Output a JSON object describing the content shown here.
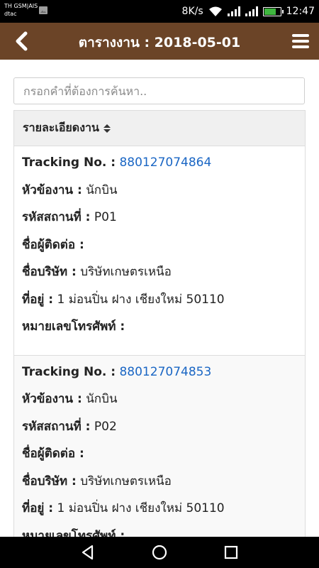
{
  "status_bar": {
    "carrier_line1": "TH GSM|AIS",
    "carrier_line2": "dtac",
    "speed": "8K/s",
    "time": "12:47",
    "battery_color": "#3fb63f"
  },
  "header": {
    "title": "ตารางงาน : 2018-05-01",
    "background_color": "#6b4427",
    "back_icon": "chevron-left-icon",
    "menu_icon": "hamburger-menu-icon"
  },
  "search": {
    "placeholder": "กรอกคำที่ต้องการค้นหา..",
    "value": ""
  },
  "table": {
    "column_header": "รายละเอียดงาน",
    "sort_icon": "sort-icon",
    "labels": {
      "tracking": "Tracking No. :",
      "topic": "หัวข้องาน :",
      "location_code": "รหัสสถานที่ :",
      "contact": "ชื่อผู้ติดต่อ :",
      "company": "ชื่อบริษัท :",
      "address": "ที่อยู่ :",
      "phone": "หมายเลขโทรศัพท์ :"
    },
    "link_color": "#1a66c4",
    "rows": [
      {
        "tracking": "880127074864",
        "topic": "นักบิน",
        "location_code": "P01",
        "contact": "",
        "company": "บริษัทเกษตรเหนือ",
        "address": "1 ม่อนปิ่น ฝาง เชียงใหม่ 50110",
        "phone": ""
      },
      {
        "tracking": "880127074853",
        "topic": "นักบิน",
        "location_code": "P02",
        "contact": "",
        "company": "บริษัทเกษตรเหนือ",
        "address": "1 ม่อนปิ่น ฝาง เชียงใหม่ 50110",
        "phone": ""
      }
    ]
  },
  "nav_bar": {
    "back_icon": "triangle-back-icon",
    "home_icon": "circle-home-icon",
    "recent_icon": "square-recent-icon"
  }
}
